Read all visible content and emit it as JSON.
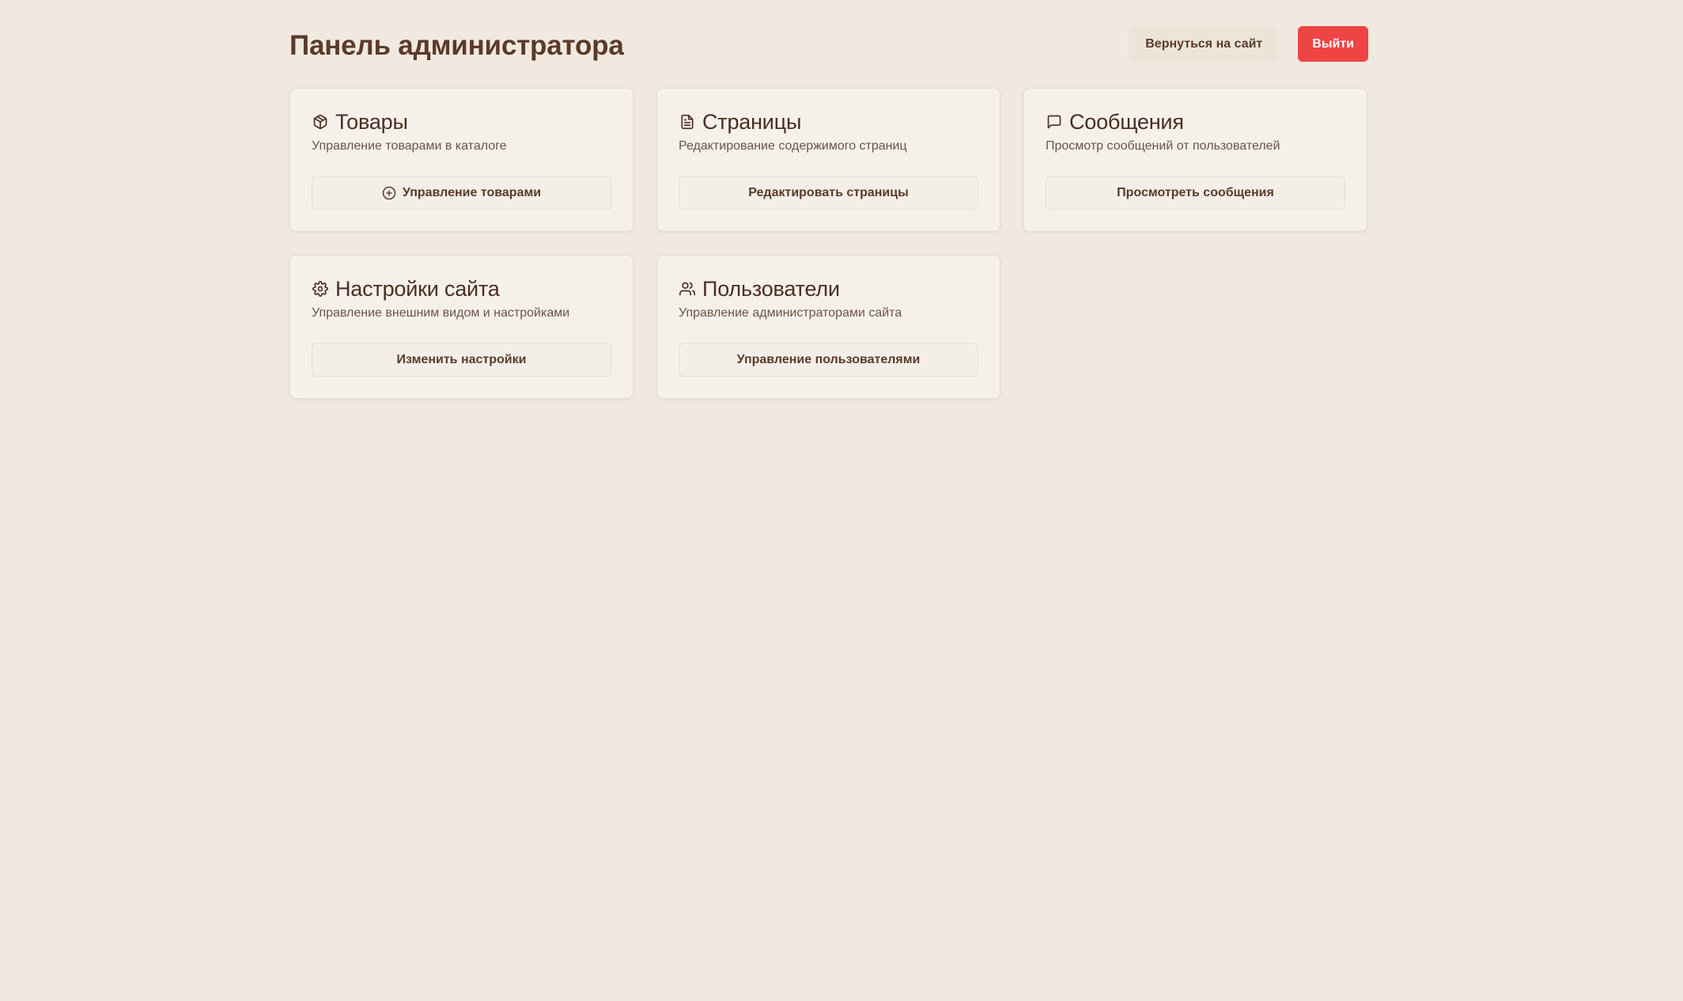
{
  "header": {
    "title": "Панель администратора",
    "back_label": "Вернуться на сайт",
    "logout_label": "Выйти"
  },
  "colors": {
    "background": "#f1e9df",
    "card": "#f5f1ea",
    "text": "#5b3a29",
    "danger": "#ef4444"
  },
  "cards": [
    {
      "icon": "package-icon",
      "title": "Товары",
      "description": "Управление товарами в каталоге",
      "button_icon": "plus-circle-icon",
      "button_label": "Управление товарами"
    },
    {
      "icon": "file-text-icon",
      "title": "Страницы",
      "description": "Редактирование содержимого страниц",
      "button_label": "Редактировать страницы"
    },
    {
      "icon": "message-square-icon",
      "title": "Сообщения",
      "description": "Просмотр сообщений от пользователей",
      "button_label": "Просмотреть сообщения"
    },
    {
      "icon": "gear-icon",
      "title": "Настройки сайта",
      "description": "Управление внешним видом и настройками",
      "button_label": "Изменить настройки"
    },
    {
      "icon": "users-icon",
      "title": "Пользователи",
      "description": "Управление администраторами сайта",
      "button_label": "Управление пользователями"
    }
  ]
}
